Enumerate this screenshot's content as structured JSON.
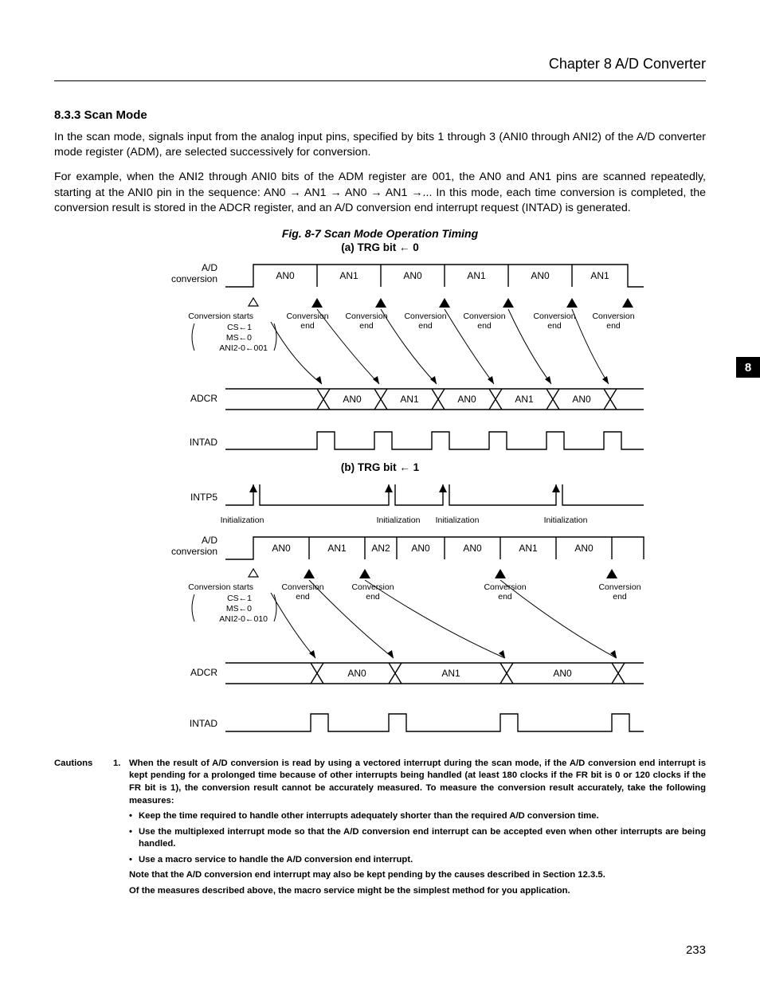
{
  "header": {
    "chapter": "Chapter 8  A/D Converter"
  },
  "side_tab": "8",
  "page_number": "233",
  "section": {
    "number_title": "8.3.3  Scan Mode",
    "p1": "In the scan mode, signals input from the analog input pins, specified by bits 1 through 3 (ANI0 through ANI2) of the A/D converter mode register (ADM), are selected successively for conversion.",
    "p2": "For example, when the ANI2 through ANI0 bits of the ADM register are 001, the AN0 and AN1 pins are scanned repeatedly, starting at the ANI0 pin in the sequence:  AN0 → AN1 → AN0 → AN1 →...   In this mode, each time conversion is completed, the conversion result is stored in the ADCR register, and an A/D conversion end interrupt request (INTAD) is generated."
  },
  "figure": {
    "caption": "Fig. 8-7  Scan Mode Operation Timing",
    "a": {
      "sub": "(a)  TRG bit ← 0",
      "row_ad": "A/D\nconversion",
      "row_adcr": "ADCR",
      "row_intad": "INTAD",
      "start_label": "Conversion starts",
      "start_lines": [
        "CS←1",
        "MS←0",
        "ANI2-0←001"
      ],
      "end_label": "Conversion\nend",
      "adc_cells": [
        "AN0",
        "AN1",
        "AN0",
        "AN1",
        "AN0",
        "AN1"
      ],
      "adcr_cells": [
        "AN0",
        "AN1",
        "AN0",
        "AN1",
        "AN0"
      ]
    },
    "b": {
      "sub": "(b)  TRG bit ← 1",
      "row_intp5": "INTP5",
      "row_ad": "A/D\nconversion",
      "row_adcr": "ADCR",
      "row_intad": "INTAD",
      "init_label": "Initialization",
      "start_label": "Conversion starts",
      "start_lines": [
        "CS←1",
        "MS←0",
        "ANI2-0←010"
      ],
      "end_label": "Conversion\nend",
      "adc_cells": [
        "AN0",
        "AN1",
        "AN2",
        "AN0",
        "AN0",
        "AN1",
        "AN0"
      ],
      "adcr_cells": [
        "AN0",
        "AN1",
        "AN0"
      ]
    }
  },
  "cautions": {
    "label": "Cautions",
    "num": "1.",
    "body": "When the result of A/D conversion is read by using a vectored interrupt during the scan mode, if the A/D conversion end interrupt is kept pending for a prolonged time because of other interrupts being handled (at least 180 clocks if the FR bit is 0 or 120 clocks if the FR bit is 1), the conversion result cannot be accurately measured.  To measure the conversion result accurately, take the following measures:",
    "bullets": [
      "Keep the time required to handle other interrupts adequately shorter than the required A/D conversion time.",
      "Use the multiplexed interrupt mode so that the A/D conversion end interrupt can be accepted even when other interrupts are being handled.",
      "Use a macro service to handle the A/D conversion end interrupt."
    ],
    "note1": "Note that the A/D conversion end interrupt may also be kept pending by the causes described in Section 12.3.5.",
    "note2": "Of the measures described above, the macro service might be the simplest method for you application."
  }
}
